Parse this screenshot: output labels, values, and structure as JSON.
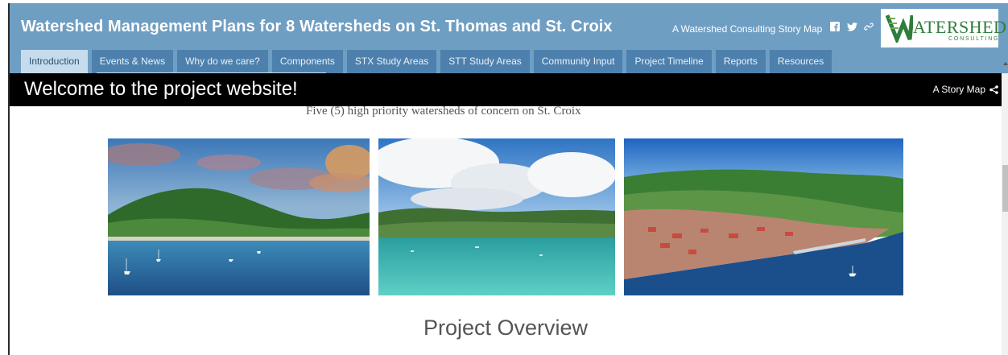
{
  "header": {
    "title": "Watershed Management Plans for 8 Watersheds on St. Thomas and St. Croix",
    "tagline": "A Watershed Consulting Story Map",
    "social_icons": [
      "facebook-icon",
      "twitter-icon",
      "link-icon"
    ],
    "logo": {
      "word": "ATERSHED",
      "sub": "CONSULTING",
      "color": "#2f7d3d"
    },
    "background_color": "#6f9ec3"
  },
  "tabs": [
    {
      "label": "Introduction",
      "active": true
    },
    {
      "label": "Events & News",
      "active": false
    },
    {
      "label": "Why do we care?",
      "active": false
    },
    {
      "label": "Components",
      "active": false
    },
    {
      "label": "STX Study Areas",
      "active": false
    },
    {
      "label": "STT Study Areas",
      "active": false
    },
    {
      "label": "Community Input",
      "active": false
    },
    {
      "label": "Project Timeline",
      "active": false
    },
    {
      "label": "Reports",
      "active": false
    },
    {
      "label": "Resources",
      "active": false
    }
  ],
  "banner": {
    "title": "Welcome to the project website!",
    "story_map_label": "A Story Map",
    "share_icon": "share-icon"
  },
  "content": {
    "caption": "Five (5) high priority watersheds of concern on St. Croix",
    "photos": [
      "harbor-sunset-photo",
      "turquoise-bay-photo",
      "aerial-town-photo"
    ],
    "section_heading": "Project Overview"
  }
}
